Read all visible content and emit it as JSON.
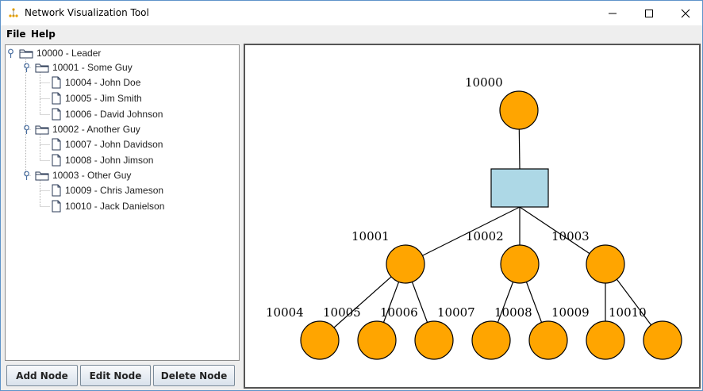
{
  "window": {
    "title": "Network Visualization Tool"
  },
  "menu": {
    "file": "File",
    "help": "Help"
  },
  "tree": {
    "root": {
      "label": "10000 - Leader"
    },
    "groups": [
      {
        "label": "10001 - Some Guy",
        "children": [
          "10004 - John Doe",
          "10005 - Jim Smith",
          "10006 - David Johnson"
        ]
      },
      {
        "label": "10002 - Another Guy",
        "children": [
          "10007 - John Davidson",
          "10008 - John Jimson"
        ]
      },
      {
        "label": "10003 - Other Guy",
        "children": [
          "10009 - Chris Jameson",
          "10010 - Jack Danielson"
        ]
      }
    ]
  },
  "buttons": {
    "add": "Add Node",
    "edit": "Edit Node",
    "delete": "Delete Node"
  },
  "graph": {
    "node_color": "#ffa500",
    "hub_color": "#add8e6",
    "root": "10000",
    "mid": [
      "10001",
      "10002",
      "10003"
    ],
    "leaves": [
      "10004",
      "10005",
      "10006",
      "10007",
      "10008",
      "10009",
      "10010"
    ]
  }
}
